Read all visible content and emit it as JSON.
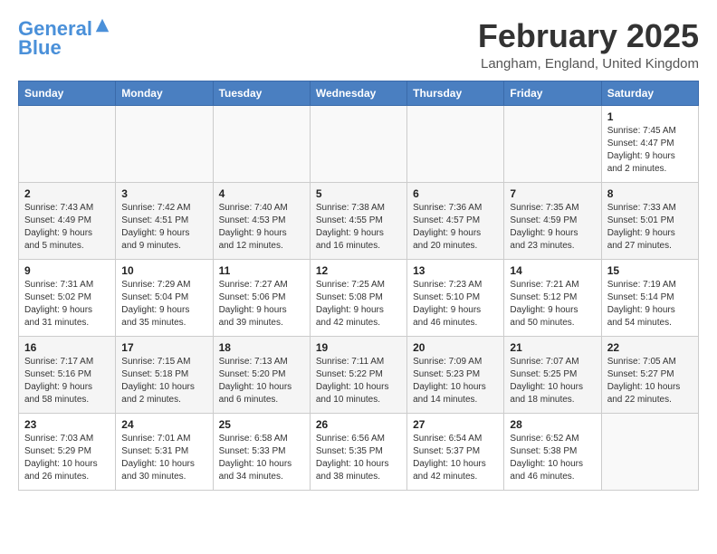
{
  "header": {
    "logo_line1": "General",
    "logo_line2": "Blue",
    "month": "February 2025",
    "location": "Langham, England, United Kingdom"
  },
  "weekdays": [
    "Sunday",
    "Monday",
    "Tuesday",
    "Wednesday",
    "Thursday",
    "Friday",
    "Saturday"
  ],
  "weeks": [
    [
      {
        "day": "",
        "info": ""
      },
      {
        "day": "",
        "info": ""
      },
      {
        "day": "",
        "info": ""
      },
      {
        "day": "",
        "info": ""
      },
      {
        "day": "",
        "info": ""
      },
      {
        "day": "",
        "info": ""
      },
      {
        "day": "1",
        "info": "Sunrise: 7:45 AM\nSunset: 4:47 PM\nDaylight: 9 hours and 2 minutes."
      }
    ],
    [
      {
        "day": "2",
        "info": "Sunrise: 7:43 AM\nSunset: 4:49 PM\nDaylight: 9 hours and 5 minutes."
      },
      {
        "day": "3",
        "info": "Sunrise: 7:42 AM\nSunset: 4:51 PM\nDaylight: 9 hours and 9 minutes."
      },
      {
        "day": "4",
        "info": "Sunrise: 7:40 AM\nSunset: 4:53 PM\nDaylight: 9 hours and 12 minutes."
      },
      {
        "day": "5",
        "info": "Sunrise: 7:38 AM\nSunset: 4:55 PM\nDaylight: 9 hours and 16 minutes."
      },
      {
        "day": "6",
        "info": "Sunrise: 7:36 AM\nSunset: 4:57 PM\nDaylight: 9 hours and 20 minutes."
      },
      {
        "day": "7",
        "info": "Sunrise: 7:35 AM\nSunset: 4:59 PM\nDaylight: 9 hours and 23 minutes."
      },
      {
        "day": "8",
        "info": "Sunrise: 7:33 AM\nSunset: 5:01 PM\nDaylight: 9 hours and 27 minutes."
      }
    ],
    [
      {
        "day": "9",
        "info": "Sunrise: 7:31 AM\nSunset: 5:02 PM\nDaylight: 9 hours and 31 minutes."
      },
      {
        "day": "10",
        "info": "Sunrise: 7:29 AM\nSunset: 5:04 PM\nDaylight: 9 hours and 35 minutes."
      },
      {
        "day": "11",
        "info": "Sunrise: 7:27 AM\nSunset: 5:06 PM\nDaylight: 9 hours and 39 minutes."
      },
      {
        "day": "12",
        "info": "Sunrise: 7:25 AM\nSunset: 5:08 PM\nDaylight: 9 hours and 42 minutes."
      },
      {
        "day": "13",
        "info": "Sunrise: 7:23 AM\nSunset: 5:10 PM\nDaylight: 9 hours and 46 minutes."
      },
      {
        "day": "14",
        "info": "Sunrise: 7:21 AM\nSunset: 5:12 PM\nDaylight: 9 hours and 50 minutes."
      },
      {
        "day": "15",
        "info": "Sunrise: 7:19 AM\nSunset: 5:14 PM\nDaylight: 9 hours and 54 minutes."
      }
    ],
    [
      {
        "day": "16",
        "info": "Sunrise: 7:17 AM\nSunset: 5:16 PM\nDaylight: 9 hours and 58 minutes."
      },
      {
        "day": "17",
        "info": "Sunrise: 7:15 AM\nSunset: 5:18 PM\nDaylight: 10 hours and 2 minutes."
      },
      {
        "day": "18",
        "info": "Sunrise: 7:13 AM\nSunset: 5:20 PM\nDaylight: 10 hours and 6 minutes."
      },
      {
        "day": "19",
        "info": "Sunrise: 7:11 AM\nSunset: 5:22 PM\nDaylight: 10 hours and 10 minutes."
      },
      {
        "day": "20",
        "info": "Sunrise: 7:09 AM\nSunset: 5:23 PM\nDaylight: 10 hours and 14 minutes."
      },
      {
        "day": "21",
        "info": "Sunrise: 7:07 AM\nSunset: 5:25 PM\nDaylight: 10 hours and 18 minutes."
      },
      {
        "day": "22",
        "info": "Sunrise: 7:05 AM\nSunset: 5:27 PM\nDaylight: 10 hours and 22 minutes."
      }
    ],
    [
      {
        "day": "23",
        "info": "Sunrise: 7:03 AM\nSunset: 5:29 PM\nDaylight: 10 hours and 26 minutes."
      },
      {
        "day": "24",
        "info": "Sunrise: 7:01 AM\nSunset: 5:31 PM\nDaylight: 10 hours and 30 minutes."
      },
      {
        "day": "25",
        "info": "Sunrise: 6:58 AM\nSunset: 5:33 PM\nDaylight: 10 hours and 34 minutes."
      },
      {
        "day": "26",
        "info": "Sunrise: 6:56 AM\nSunset: 5:35 PM\nDaylight: 10 hours and 38 minutes."
      },
      {
        "day": "27",
        "info": "Sunrise: 6:54 AM\nSunset: 5:37 PM\nDaylight: 10 hours and 42 minutes."
      },
      {
        "day": "28",
        "info": "Sunrise: 6:52 AM\nSunset: 5:38 PM\nDaylight: 10 hours and 46 minutes."
      },
      {
        "day": "",
        "info": ""
      }
    ]
  ]
}
